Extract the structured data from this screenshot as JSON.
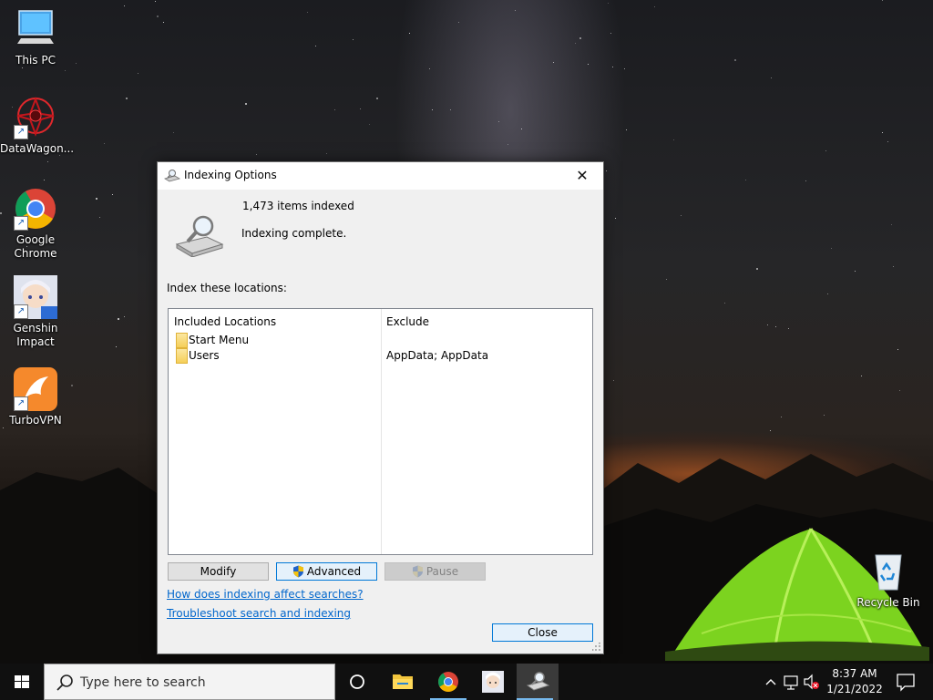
{
  "desktop": {
    "icons": [
      {
        "label": "This PC",
        "icon": "computer-icon"
      },
      {
        "label": "DataWagon...",
        "icon": "datawagon-icon"
      },
      {
        "label": "Google Chrome",
        "icon": "chrome-icon"
      },
      {
        "label": "Genshin Impact",
        "icon": "genshin-icon"
      },
      {
        "label": "TurboVPN",
        "icon": "turbovpn-icon"
      },
      {
        "label": "Recycle Bin",
        "icon": "recycle-bin-icon"
      }
    ]
  },
  "dialog": {
    "title": "Indexing Options",
    "close_glyph": "✕",
    "items_count": "1,473 items indexed",
    "status": "Indexing complete.",
    "locations_label": "Index these locations:",
    "columns": {
      "included": "Included Locations",
      "exclude": "Exclude"
    },
    "rows": [
      {
        "location": "Start Menu",
        "exclude": ""
      },
      {
        "location": "Users",
        "exclude": "AppData; AppData"
      }
    ],
    "buttons": {
      "modify": "Modify",
      "advanced": "Advanced",
      "pause": "Pause",
      "close": "Close"
    },
    "links": {
      "how_affects": "How does indexing affect searches?",
      "troubleshoot": "Troubleshoot search and indexing"
    }
  },
  "taskbar": {
    "search_placeholder": "Type here to search",
    "time": "8:37 AM",
    "date": "1/21/2022",
    "accent": "#76b9ed"
  }
}
